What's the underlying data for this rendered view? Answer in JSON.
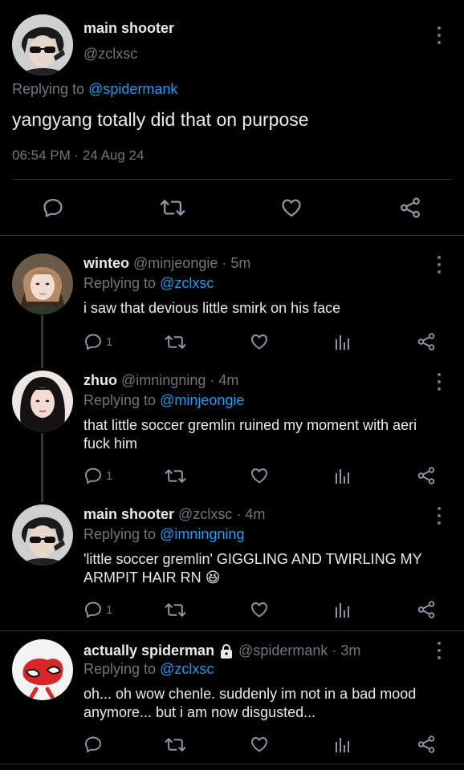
{
  "main_tweet": {
    "name": "main shooter",
    "handle": "@zclxsc",
    "replying_prefix": "Replying to",
    "replying_to": "@spidermank",
    "text": "yangyang totally did that on purpose",
    "timestamp": "06:54 PM · 24 Aug 24"
  },
  "replies": [
    {
      "name": "winteo",
      "handle": "@minjeongie",
      "time": "· 5m",
      "replying_prefix": "Replying to",
      "replying_to": "@zclxsc",
      "text": "i saw that devious little smirk on his face",
      "reply_count": "1"
    },
    {
      "name": "zhuo",
      "handle": "@imningning",
      "time": "· 4m",
      "replying_prefix": "Replying to",
      "replying_to": "@minjeongie",
      "text": "that little soccer gremlin ruined my moment with aeri fuck him",
      "reply_count": "1"
    },
    {
      "name": "main shooter",
      "handle": "@zclxsc",
      "time": "· 4m",
      "replying_prefix": "Replying to",
      "replying_to": "@imningning",
      "text": "'little soccer gremlin' GIGGLING AND TWIRLING MY ARMPIT HAIR RN",
      "emoji": "😆",
      "reply_count": "1"
    },
    {
      "name": "actually spiderman",
      "handle": "@spidermank",
      "time": "· 3m",
      "replying_prefix": "Replying to",
      "replying_to": "@zclxsc",
      "text": "oh... oh wow chenle. suddenly im not in a bad mood anymore... but i am now disgusted...",
      "reply_count": ""
    }
  ],
  "colors": {
    "background": "#000000",
    "link": "#1d9bf0",
    "muted": "#71767b",
    "text": "#e7e9ea"
  }
}
